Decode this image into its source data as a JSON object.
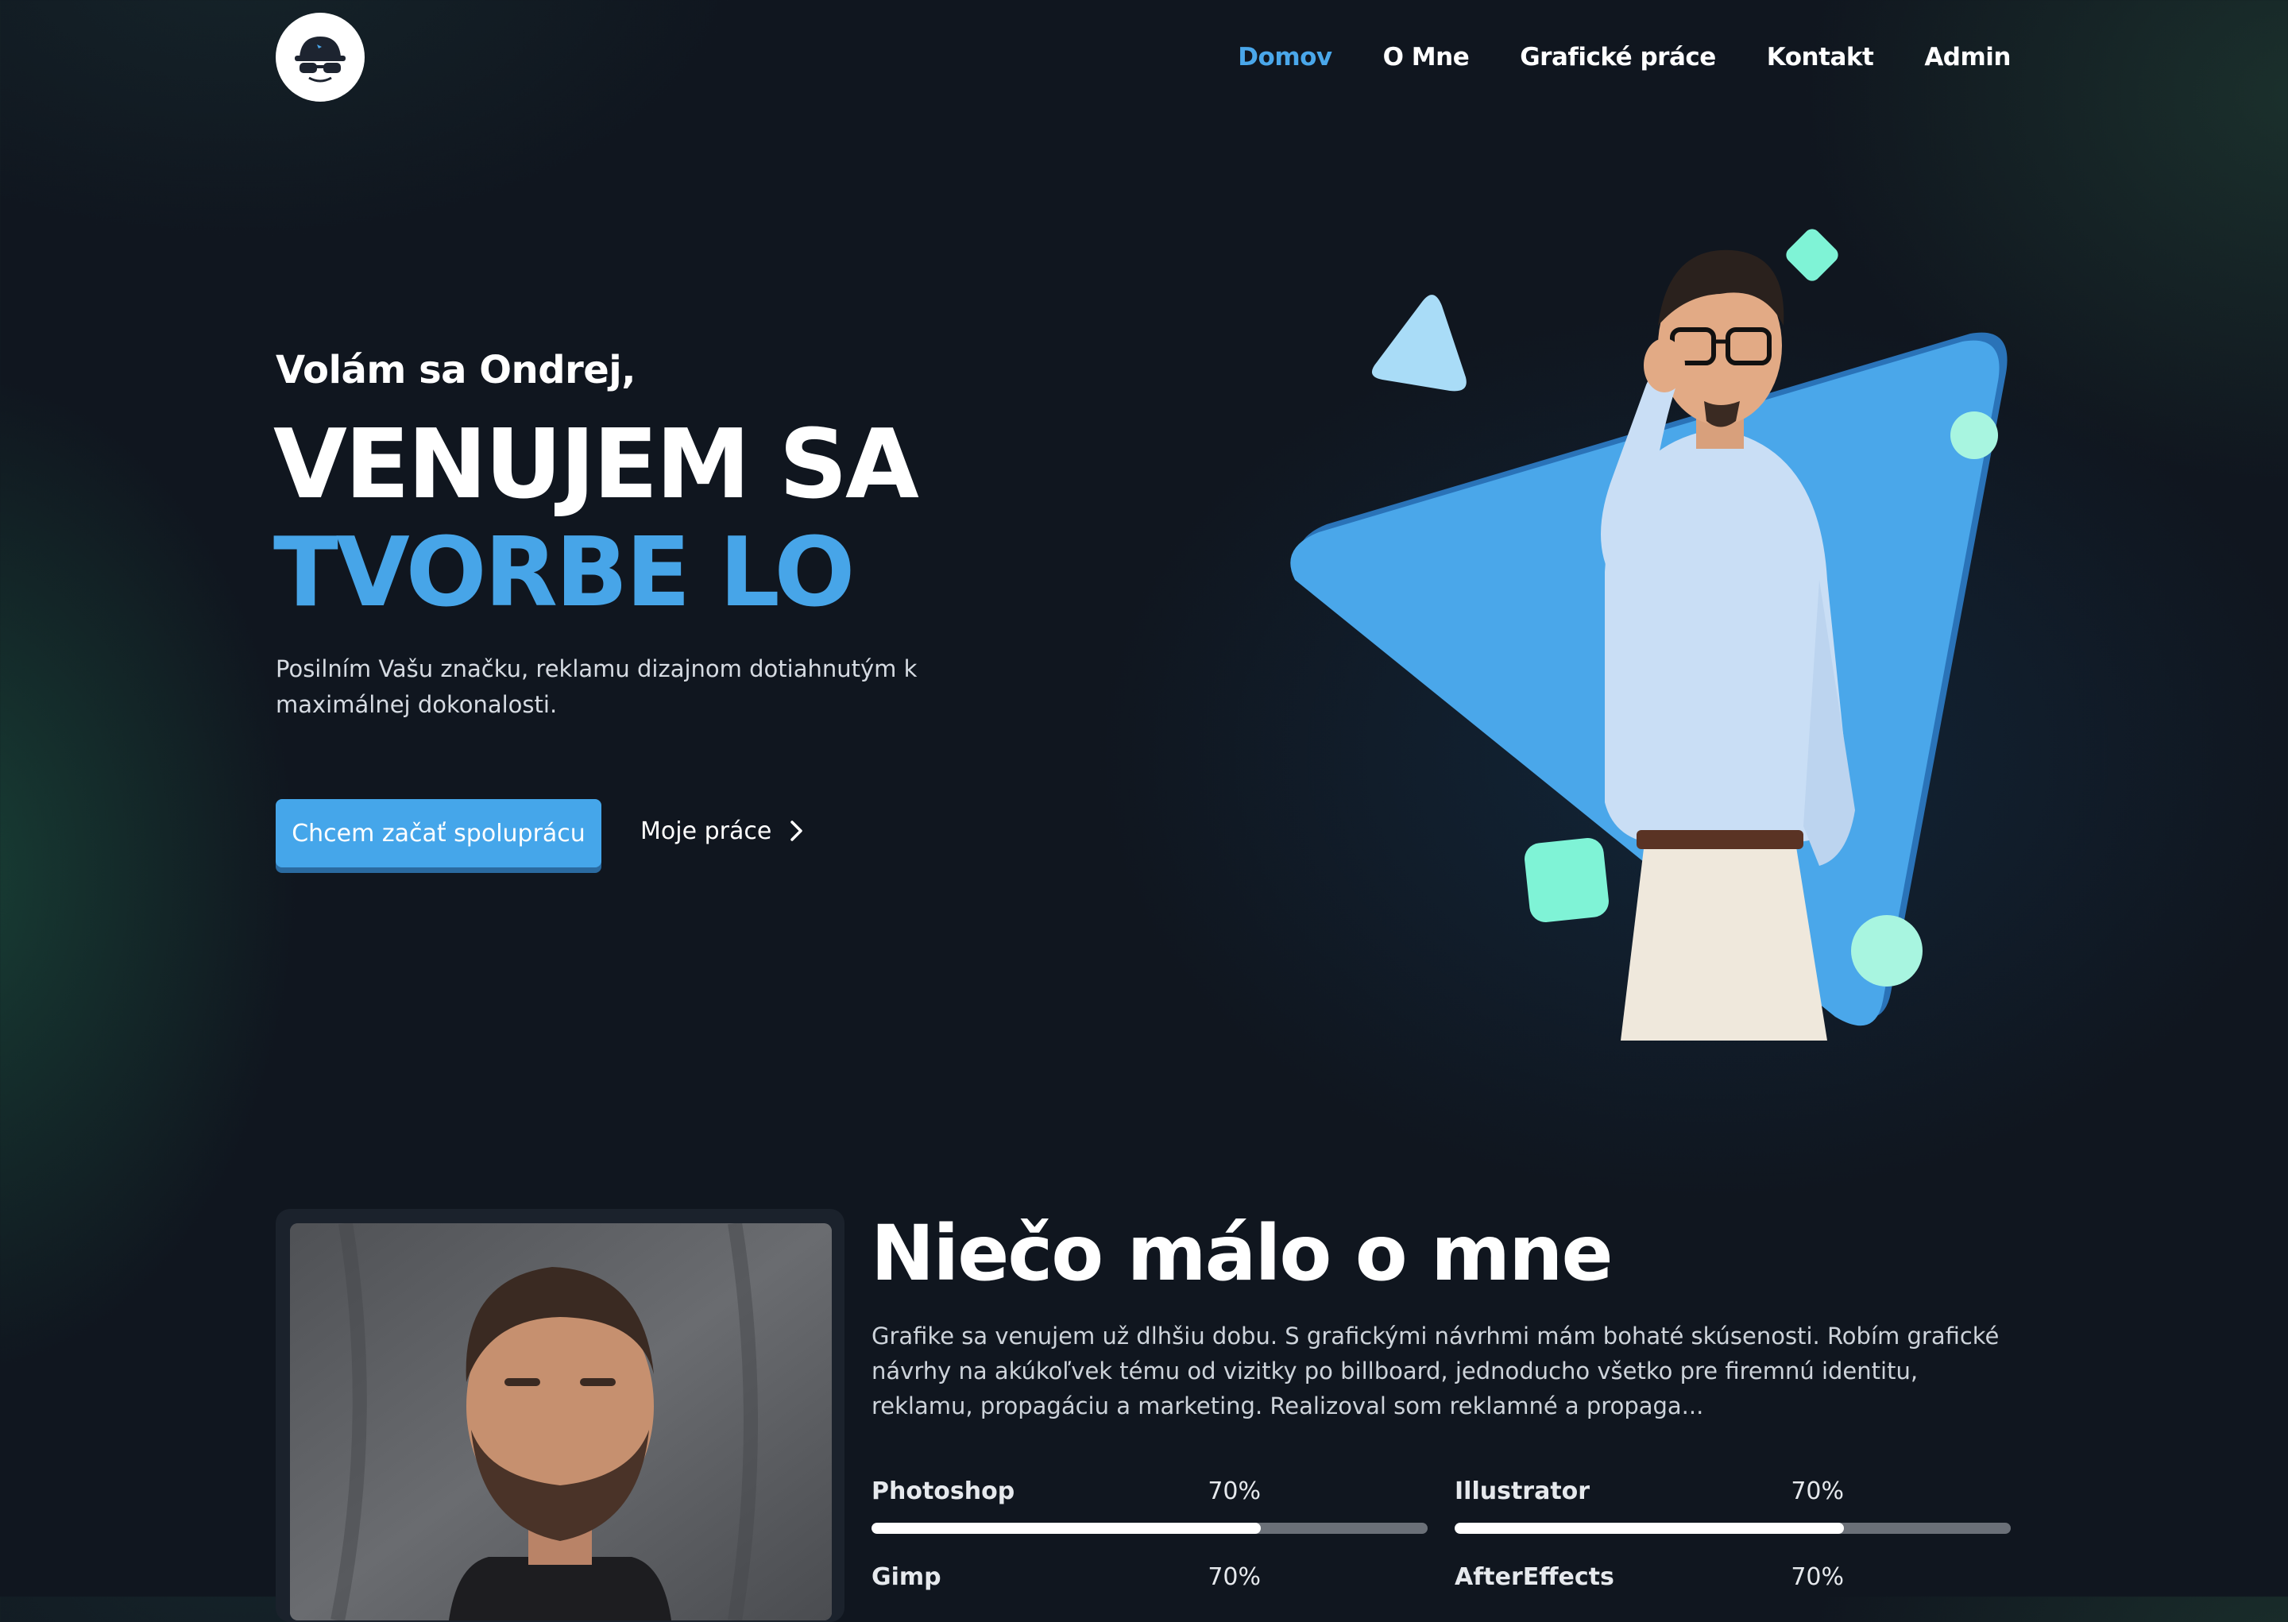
{
  "nav": {
    "items": [
      {
        "label": "Domov",
        "active": true
      },
      {
        "label": "O Mne",
        "active": false
      },
      {
        "label": "Grafické práce",
        "active": false
      },
      {
        "label": "Kontakt",
        "active": false
      },
      {
        "label": "Admin",
        "active": false
      }
    ]
  },
  "hero": {
    "greeting": "Volám sa Ondrej,",
    "headline_line1": "VENUJEM SA",
    "headline_line2": "TVORBE LO",
    "description": "Posilním Vašu značku, reklamu dizajnom dotiahnutým k maximálnej dokonalosti.",
    "primary_button": "Chcem začať spoluprácu",
    "secondary_link": "Moje práce"
  },
  "about": {
    "title": "Niečo málo o mne",
    "text": "Grafike sa venujem už dlhšiu dobu. S grafickými návrhmi mám bohaté skúsenosti. Robím grafické návrhy na akúkoľvek tému od vizitky po billboard, jednoducho všetko pre firemnú identitu, reklamu, propagáciu a marketing. Realizoval som reklamné a propaga...",
    "skills": [
      {
        "name": "Photoshop",
        "percent_label": "70%",
        "level": 0.7
      },
      {
        "name": "Illustrator",
        "percent_label": "70%",
        "level": 0.7
      },
      {
        "name": "Gimp",
        "percent_label": "70%",
        "level": 0.7
      },
      {
        "name": "AfterEffects",
        "percent_label": "70%",
        "level": 0.7
      }
    ]
  },
  "colors": {
    "accent": "#47a5e8",
    "mint": "#7ff3d6",
    "background": "#10161f"
  }
}
